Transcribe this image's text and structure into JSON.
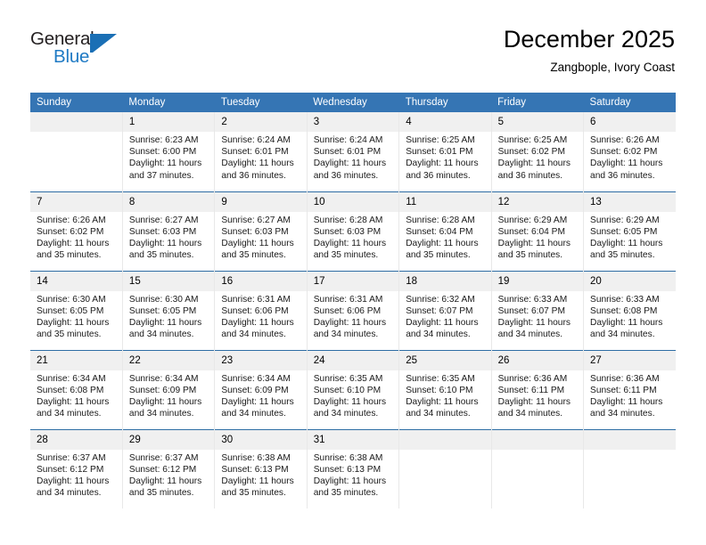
{
  "brand": {
    "name_part1": "General",
    "name_part2": "Blue"
  },
  "header": {
    "title": "December 2025",
    "subtitle": "Zangbople, Ivory Coast"
  },
  "colors": {
    "header_blue": "#3575b4",
    "separator_blue": "#2e6da4",
    "daynum_background": "#f0f0f0",
    "logo_blue": "#1f7ac4"
  },
  "weekdays": [
    "Sunday",
    "Monday",
    "Tuesday",
    "Wednesday",
    "Thursday",
    "Friday",
    "Saturday"
  ],
  "weeks": [
    [
      {
        "day": "",
        "sunrise": "",
        "sunset": "",
        "daylight1": "",
        "daylight2": ""
      },
      {
        "day": "1",
        "sunrise": "Sunrise: 6:23 AM",
        "sunset": "Sunset: 6:00 PM",
        "daylight1": "Daylight: 11 hours",
        "daylight2": "and 37 minutes."
      },
      {
        "day": "2",
        "sunrise": "Sunrise: 6:24 AM",
        "sunset": "Sunset: 6:01 PM",
        "daylight1": "Daylight: 11 hours",
        "daylight2": "and 36 minutes."
      },
      {
        "day": "3",
        "sunrise": "Sunrise: 6:24 AM",
        "sunset": "Sunset: 6:01 PM",
        "daylight1": "Daylight: 11 hours",
        "daylight2": "and 36 minutes."
      },
      {
        "day": "4",
        "sunrise": "Sunrise: 6:25 AM",
        "sunset": "Sunset: 6:01 PM",
        "daylight1": "Daylight: 11 hours",
        "daylight2": "and 36 minutes."
      },
      {
        "day": "5",
        "sunrise": "Sunrise: 6:25 AM",
        "sunset": "Sunset: 6:02 PM",
        "daylight1": "Daylight: 11 hours",
        "daylight2": "and 36 minutes."
      },
      {
        "day": "6",
        "sunrise": "Sunrise: 6:26 AM",
        "sunset": "Sunset: 6:02 PM",
        "daylight1": "Daylight: 11 hours",
        "daylight2": "and 36 minutes."
      }
    ],
    [
      {
        "day": "7",
        "sunrise": "Sunrise: 6:26 AM",
        "sunset": "Sunset: 6:02 PM",
        "daylight1": "Daylight: 11 hours",
        "daylight2": "and 35 minutes."
      },
      {
        "day": "8",
        "sunrise": "Sunrise: 6:27 AM",
        "sunset": "Sunset: 6:03 PM",
        "daylight1": "Daylight: 11 hours",
        "daylight2": "and 35 minutes."
      },
      {
        "day": "9",
        "sunrise": "Sunrise: 6:27 AM",
        "sunset": "Sunset: 6:03 PM",
        "daylight1": "Daylight: 11 hours",
        "daylight2": "and 35 minutes."
      },
      {
        "day": "10",
        "sunrise": "Sunrise: 6:28 AM",
        "sunset": "Sunset: 6:03 PM",
        "daylight1": "Daylight: 11 hours",
        "daylight2": "and 35 minutes."
      },
      {
        "day": "11",
        "sunrise": "Sunrise: 6:28 AM",
        "sunset": "Sunset: 6:04 PM",
        "daylight1": "Daylight: 11 hours",
        "daylight2": "and 35 minutes."
      },
      {
        "day": "12",
        "sunrise": "Sunrise: 6:29 AM",
        "sunset": "Sunset: 6:04 PM",
        "daylight1": "Daylight: 11 hours",
        "daylight2": "and 35 minutes."
      },
      {
        "day": "13",
        "sunrise": "Sunrise: 6:29 AM",
        "sunset": "Sunset: 6:05 PM",
        "daylight1": "Daylight: 11 hours",
        "daylight2": "and 35 minutes."
      }
    ],
    [
      {
        "day": "14",
        "sunrise": "Sunrise: 6:30 AM",
        "sunset": "Sunset: 6:05 PM",
        "daylight1": "Daylight: 11 hours",
        "daylight2": "and 35 minutes."
      },
      {
        "day": "15",
        "sunrise": "Sunrise: 6:30 AM",
        "sunset": "Sunset: 6:05 PM",
        "daylight1": "Daylight: 11 hours",
        "daylight2": "and 34 minutes."
      },
      {
        "day": "16",
        "sunrise": "Sunrise: 6:31 AM",
        "sunset": "Sunset: 6:06 PM",
        "daylight1": "Daylight: 11 hours",
        "daylight2": "and 34 minutes."
      },
      {
        "day": "17",
        "sunrise": "Sunrise: 6:31 AM",
        "sunset": "Sunset: 6:06 PM",
        "daylight1": "Daylight: 11 hours",
        "daylight2": "and 34 minutes."
      },
      {
        "day": "18",
        "sunrise": "Sunrise: 6:32 AM",
        "sunset": "Sunset: 6:07 PM",
        "daylight1": "Daylight: 11 hours",
        "daylight2": "and 34 minutes."
      },
      {
        "day": "19",
        "sunrise": "Sunrise: 6:33 AM",
        "sunset": "Sunset: 6:07 PM",
        "daylight1": "Daylight: 11 hours",
        "daylight2": "and 34 minutes."
      },
      {
        "day": "20",
        "sunrise": "Sunrise: 6:33 AM",
        "sunset": "Sunset: 6:08 PM",
        "daylight1": "Daylight: 11 hours",
        "daylight2": "and 34 minutes."
      }
    ],
    [
      {
        "day": "21",
        "sunrise": "Sunrise: 6:34 AM",
        "sunset": "Sunset: 6:08 PM",
        "daylight1": "Daylight: 11 hours",
        "daylight2": "and 34 minutes."
      },
      {
        "day": "22",
        "sunrise": "Sunrise: 6:34 AM",
        "sunset": "Sunset: 6:09 PM",
        "daylight1": "Daylight: 11 hours",
        "daylight2": "and 34 minutes."
      },
      {
        "day": "23",
        "sunrise": "Sunrise: 6:34 AM",
        "sunset": "Sunset: 6:09 PM",
        "daylight1": "Daylight: 11 hours",
        "daylight2": "and 34 minutes."
      },
      {
        "day": "24",
        "sunrise": "Sunrise: 6:35 AM",
        "sunset": "Sunset: 6:10 PM",
        "daylight1": "Daylight: 11 hours",
        "daylight2": "and 34 minutes."
      },
      {
        "day": "25",
        "sunrise": "Sunrise: 6:35 AM",
        "sunset": "Sunset: 6:10 PM",
        "daylight1": "Daylight: 11 hours",
        "daylight2": "and 34 minutes."
      },
      {
        "day": "26",
        "sunrise": "Sunrise: 6:36 AM",
        "sunset": "Sunset: 6:11 PM",
        "daylight1": "Daylight: 11 hours",
        "daylight2": "and 34 minutes."
      },
      {
        "day": "27",
        "sunrise": "Sunrise: 6:36 AM",
        "sunset": "Sunset: 6:11 PM",
        "daylight1": "Daylight: 11 hours",
        "daylight2": "and 34 minutes."
      }
    ],
    [
      {
        "day": "28",
        "sunrise": "Sunrise: 6:37 AM",
        "sunset": "Sunset: 6:12 PM",
        "daylight1": "Daylight: 11 hours",
        "daylight2": "and 34 minutes."
      },
      {
        "day": "29",
        "sunrise": "Sunrise: 6:37 AM",
        "sunset": "Sunset: 6:12 PM",
        "daylight1": "Daylight: 11 hours",
        "daylight2": "and 35 minutes."
      },
      {
        "day": "30",
        "sunrise": "Sunrise: 6:38 AM",
        "sunset": "Sunset: 6:13 PM",
        "daylight1": "Daylight: 11 hours",
        "daylight2": "and 35 minutes."
      },
      {
        "day": "31",
        "sunrise": "Sunrise: 6:38 AM",
        "sunset": "Sunset: 6:13 PM",
        "daylight1": "Daylight: 11 hours",
        "daylight2": "and 35 minutes."
      },
      {
        "day": "",
        "sunrise": "",
        "sunset": "",
        "daylight1": "",
        "daylight2": ""
      },
      {
        "day": "",
        "sunrise": "",
        "sunset": "",
        "daylight1": "",
        "daylight2": ""
      },
      {
        "day": "",
        "sunrise": "",
        "sunset": "",
        "daylight1": "",
        "daylight2": ""
      }
    ]
  ]
}
